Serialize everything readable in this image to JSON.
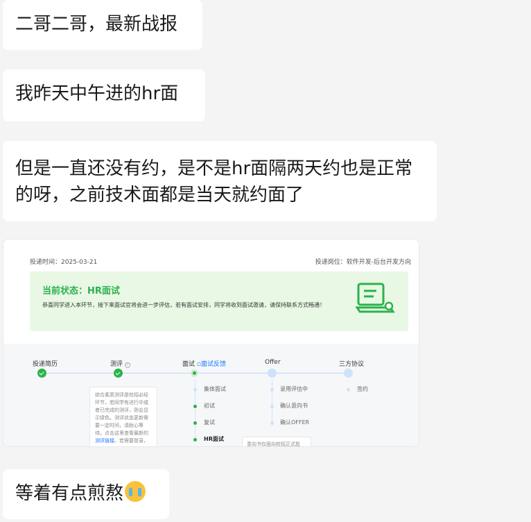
{
  "messages": [
    {
      "text": "二哥二哥，最新战报"
    },
    {
      "text": "我昨天中午进的hr面"
    },
    {
      "text": "但是一直还没有约，是不是hr面隔两天约也是正常的呀，之前技术面都是当天就约面了"
    },
    {
      "text": "等着有点煎熬"
    }
  ],
  "screenshot": {
    "submit_time": "投递时间：2025-03-21",
    "position": "投递岗位：软件开发-后台开发方向",
    "status_title": "当前状态：HR面试",
    "status_desc": "恭喜同学进入本环节，接下来面试官将会进一步评估，若有面试安排，同学将收到面试邀请，请保持联系方式畅通！",
    "steps": {
      "resume": "投递简历",
      "assessment": "测评",
      "interview": "面试",
      "feedback": "面试反馈",
      "offer": "Offer",
      "tripartite": "三方协议"
    },
    "tip": "综合素质测评是校招必经环节，若同学有进行中或者已完成的测评，则会显示绿色。测评状态更新需要一定时间，请耐心等待。点击这里查看最新的",
    "tip_link": "测评链接",
    "tip_tail": "。若需要登录，",
    "interview_sub": [
      "集体面试",
      "初试",
      "复试",
      "HR面试"
    ],
    "offer_sub": [
      "录用评估中",
      "确认意向书",
      "确认OFFER"
    ],
    "tripartite_sub": [
      "签约"
    ],
    "letter": "意向书仅面向校招正式批"
  },
  "colors": {
    "accent_green": "#2bb24c",
    "link_blue": "#1677ff",
    "bubble": "#ffffff",
    "background": "#f4f4f4"
  }
}
